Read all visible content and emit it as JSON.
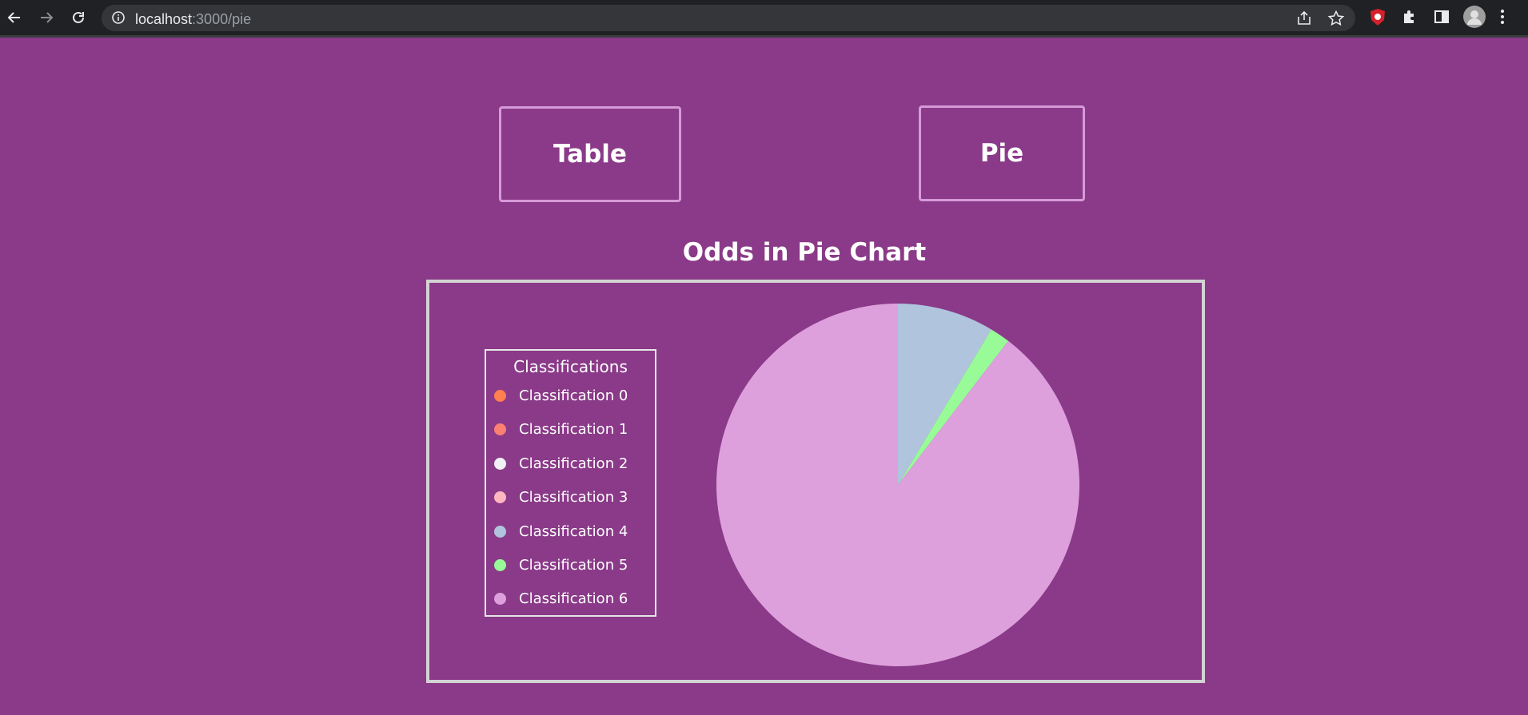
{
  "browser": {
    "url_host": "localhost",
    "url_path": ":3000/pie"
  },
  "nav": {
    "table_label": "Table",
    "pie_label": "Pie"
  },
  "page": {
    "background": "#8a3a88"
  },
  "chart_data": {
    "type": "pie",
    "title": "Odds in Pie Chart",
    "legend_title": "Classifications",
    "legend_position": "left",
    "slices": [
      {
        "label": "Classification 0",
        "value": 0,
        "color": "#ff7f50"
      },
      {
        "label": "Classification 1",
        "value": 0,
        "color": "#fa8072"
      },
      {
        "label": "Classification 2",
        "value": 0,
        "color": "#f0f0f5"
      },
      {
        "label": "Classification 3",
        "value": 0,
        "color": "#ffb6c1"
      },
      {
        "label": "Classification 4",
        "value": 8.6,
        "color": "#b0c4de"
      },
      {
        "label": "Classification 5",
        "value": 1.8,
        "color": "#98fb98"
      },
      {
        "label": "Classification 6",
        "value": 89.6,
        "color": "#dda0dd"
      }
    ]
  }
}
